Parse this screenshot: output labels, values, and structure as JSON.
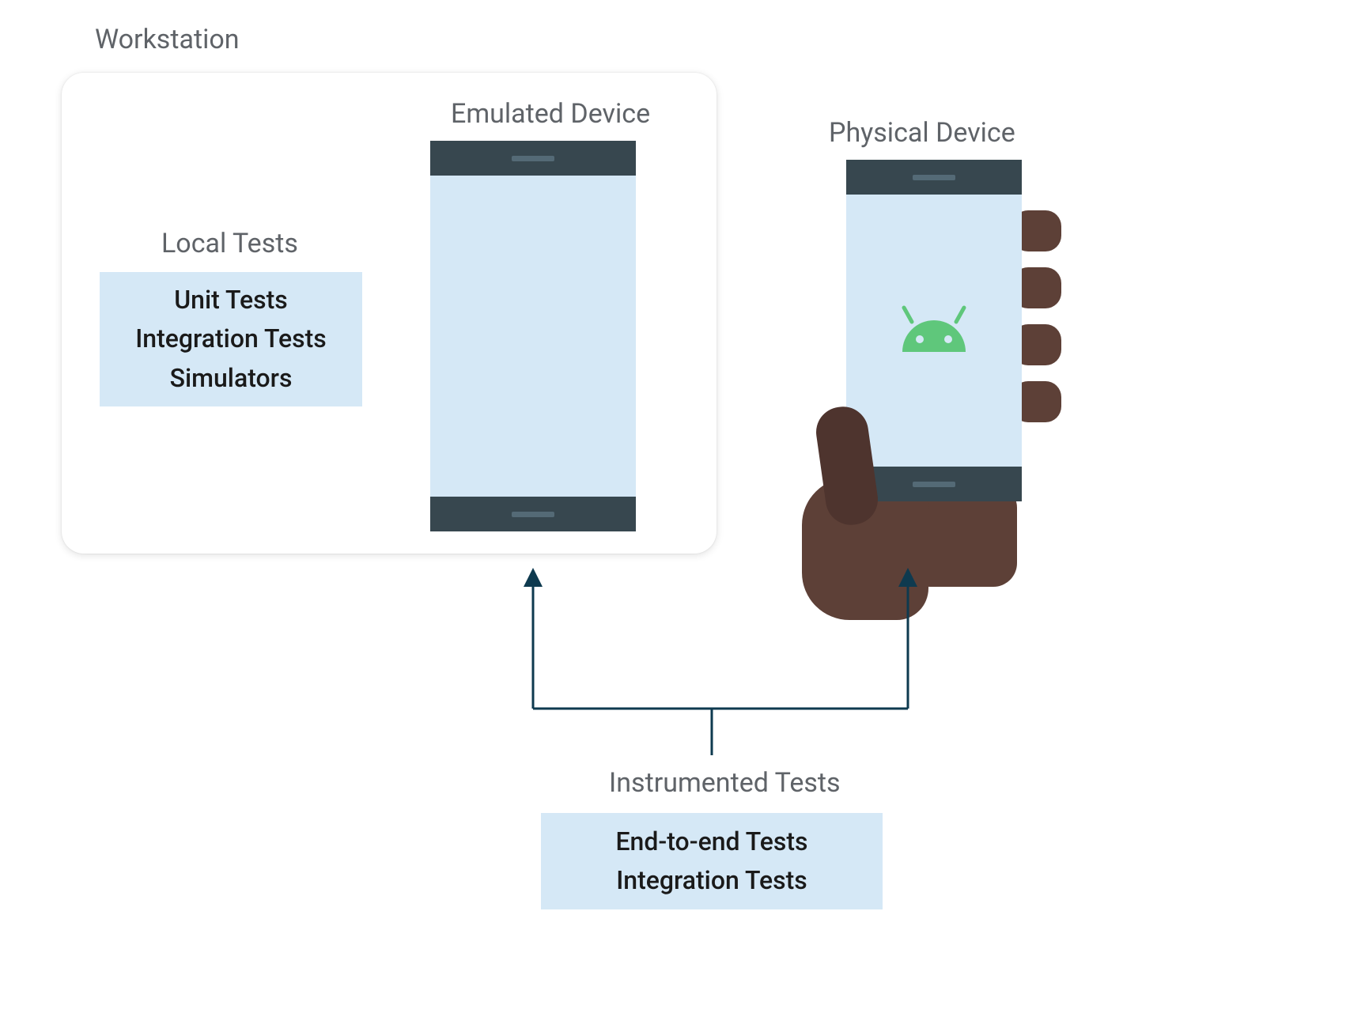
{
  "workstation": {
    "label": "Workstation"
  },
  "local_tests": {
    "label": "Local Tests",
    "items": [
      "Unit Tests",
      "Integration Tests",
      "Simulators"
    ]
  },
  "emulated": {
    "label": "Emulated Device"
  },
  "physical": {
    "label": "Physical Device"
  },
  "instrumented": {
    "label": "Instrumented Tests",
    "items": [
      "End-to-end Tests",
      "Integration Tests"
    ]
  },
  "colors": {
    "light_blue": "#d5e8f6",
    "phone_dark": "#37474f",
    "hand": "#5d4037",
    "android_green": "#5fc77b",
    "arrow": "#0e3a4f"
  }
}
